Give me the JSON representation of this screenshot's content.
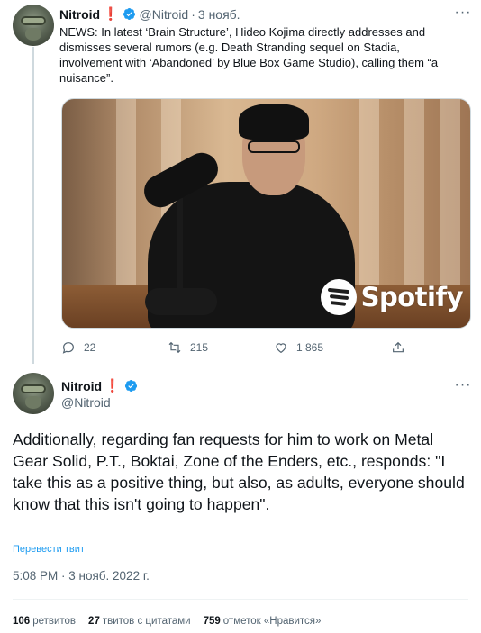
{
  "tweet1": {
    "author_name": "Nitroid",
    "author_emoji": "❗",
    "handle": "@Nitroid",
    "separator": "·",
    "time": "3 нояб.",
    "text": "NEWS: In latest ‘Brain Structure’, Hideo Kojima directly addresses and dismisses several rumors (e.g. Death Stranding sequel on Stadia, involvement with ‘Abandoned’ by Blue Box Game Studio), calling them “a nuisance”.",
    "media": {
      "overlay_logo_text": "Spotify",
      "overlay_registered_mark": "."
    },
    "actions": {
      "replies": "22",
      "retweets": "215",
      "likes": "1 865"
    }
  },
  "tweet2": {
    "author_name": "Nitroid",
    "author_emoji": "❗",
    "handle": "@Nitroid",
    "text": "Additionally, regarding fan requests for him to work on Metal Gear Solid, P.T., Boktai, Zone of the Enders, etc., responds: \"I take this as a positive thing, but also, as adults, everyone should know that this isn't going to happen\".",
    "translate_label": "Перевести твит",
    "timestamp": "5:08 PM · 3 нояб. 2022 г.",
    "stats": {
      "retweets_count": "106",
      "retweets_label": "ретвитов",
      "quotes_count": "27",
      "quotes_label": "твитов с цитатами",
      "likes_count": "759",
      "likes_label": "отметок «Нравится»"
    }
  },
  "colors": {
    "accent": "#1d9bf0",
    "secondary_text": "#536471",
    "primary_text": "#0f1419",
    "alert_red": "#e0245e",
    "spotify_logo": "#ffffff"
  },
  "icons": [
    "reply-icon",
    "retweet-icon",
    "like-icon",
    "share-icon",
    "verified-badge-icon",
    "more-options-icon",
    "spotify-logo-icon"
  ]
}
